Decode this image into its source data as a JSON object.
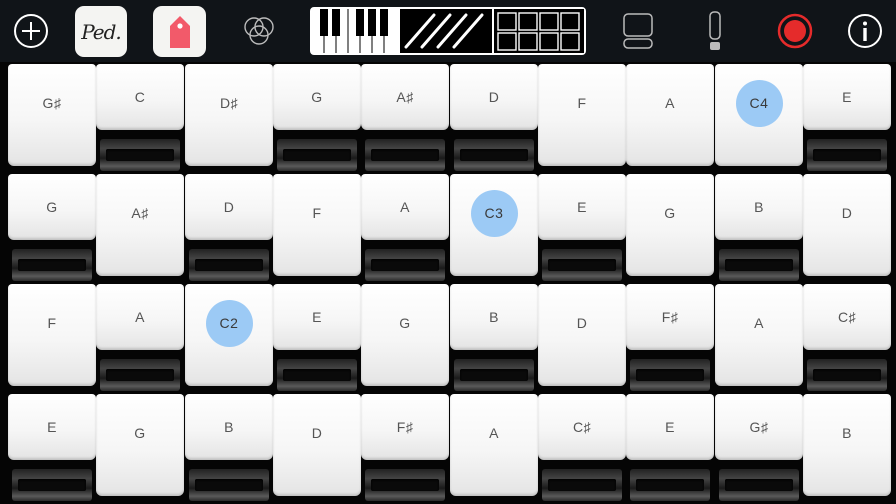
{
  "toolbar": {
    "items": [
      {
        "name": "add",
        "icon": "plus-circle-icon"
      },
      {
        "name": "pedal",
        "label": "Ped."
      },
      {
        "name": "tag",
        "icon": "tag-icon"
      },
      {
        "name": "scales",
        "icon": "overlapping-circles-icon"
      },
      {
        "name": "keyboard-mode",
        "icon": "piano-keys-icon"
      },
      {
        "name": "layout",
        "icon": "stacked-panels-icon"
      },
      {
        "name": "level",
        "icon": "level-meter-icon"
      },
      {
        "name": "record",
        "icon": "record-icon"
      },
      {
        "name": "info",
        "icon": "info-icon"
      }
    ],
    "pedal_label": "Ped.",
    "accent_record": "#e52b2b"
  },
  "grid": {
    "rows": [
      {
        "keys": [
          {
            "note": "G♯",
            "pressed": true
          },
          {
            "note": "C",
            "pressed": false
          },
          {
            "note": "D♯",
            "pressed": true
          },
          {
            "note": "G",
            "pressed": false
          },
          {
            "note": "A♯",
            "pressed": false
          },
          {
            "note": "D",
            "pressed": false
          },
          {
            "note": "F",
            "pressed": true
          },
          {
            "note": "A",
            "pressed": true
          },
          {
            "note": "C4",
            "pressed": true,
            "root": true
          },
          {
            "note": "E",
            "pressed": false
          }
        ]
      },
      {
        "keys": [
          {
            "note": "G",
            "pressed": false
          },
          {
            "note": "A♯",
            "pressed": true
          },
          {
            "note": "D",
            "pressed": false
          },
          {
            "note": "F",
            "pressed": true
          },
          {
            "note": "A",
            "pressed": false
          },
          {
            "note": "C3",
            "pressed": true,
            "root": true
          },
          {
            "note": "E",
            "pressed": false
          },
          {
            "note": "G",
            "pressed": true
          },
          {
            "note": "B",
            "pressed": false
          },
          {
            "note": "D",
            "pressed": true
          }
        ]
      },
      {
        "keys": [
          {
            "note": "F",
            "pressed": true
          },
          {
            "note": "A",
            "pressed": false
          },
          {
            "note": "C2",
            "pressed": true,
            "root": true
          },
          {
            "note": "E",
            "pressed": false
          },
          {
            "note": "G",
            "pressed": true
          },
          {
            "note": "B",
            "pressed": false
          },
          {
            "note": "D",
            "pressed": true
          },
          {
            "note": "F♯",
            "pressed": false
          },
          {
            "note": "A",
            "pressed": true
          },
          {
            "note": "C♯",
            "pressed": false
          }
        ]
      },
      {
        "keys": [
          {
            "note": "E",
            "pressed": false
          },
          {
            "note": "G",
            "pressed": true
          },
          {
            "note": "B",
            "pressed": false
          },
          {
            "note": "D",
            "pressed": true
          },
          {
            "note": "F♯",
            "pressed": false
          },
          {
            "note": "A",
            "pressed": true
          },
          {
            "note": "C♯",
            "pressed": false
          },
          {
            "note": "E",
            "pressed": false
          },
          {
            "note": "G♯",
            "pressed": false
          },
          {
            "note": "B",
            "pressed": true
          }
        ]
      }
    ],
    "root_color": "#9ccaf5"
  }
}
